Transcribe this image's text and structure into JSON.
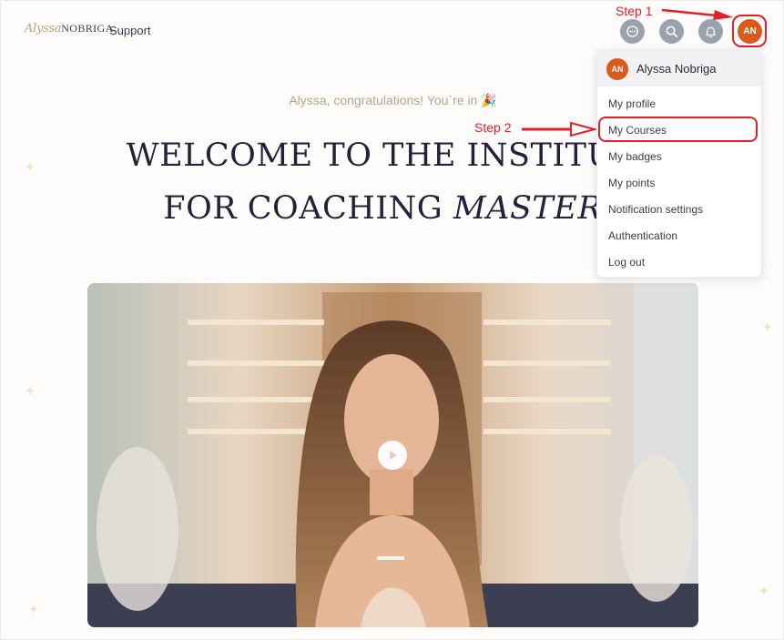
{
  "header": {
    "logo_script": "Alyssa",
    "logo_caps": "NOBRIGA",
    "support_label": "Support",
    "icons": [
      "chat-icon",
      "search-icon",
      "bell-icon"
    ],
    "avatar_initials": "AN"
  },
  "annotations": {
    "step1": "Step 1",
    "step2": "Step 2",
    "color": "#e0202a"
  },
  "hero": {
    "congrats": "Alyssa, congratulations! You`re in",
    "congrats_emoji": "🎉",
    "headline_line1": "WELCOME TO THE INSTITUTE",
    "headline_line2_plain": "FOR COACHING ",
    "headline_line2_italic": "MASTERY"
  },
  "dropdown": {
    "user_initials": "AN",
    "user_name": "Alyssa Nobriga",
    "items": [
      "My profile",
      "My Courses",
      "My badges",
      "My points",
      "Notification settings",
      "Authentication",
      "Log out"
    ]
  },
  "colors": {
    "accent": "#d95a1a",
    "headline": "#23213b",
    "congrats": "#b7a389"
  }
}
